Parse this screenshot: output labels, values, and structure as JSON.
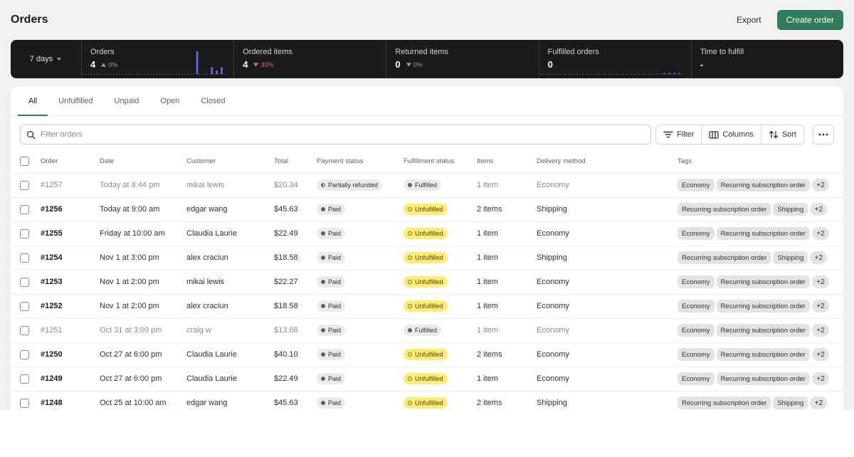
{
  "header": {
    "title": "Orders",
    "export_label": "Export",
    "create_label": "Create order"
  },
  "metrics": {
    "range_label": "7 days",
    "items": [
      {
        "label": "Orders",
        "value": "4",
        "change": "0%",
        "direction": "up",
        "negative": false,
        "spark": [
          0,
          0,
          0,
          0,
          0,
          0,
          0,
          0,
          0,
          0,
          0,
          0,
          0,
          0,
          0,
          0,
          0,
          0,
          0,
          0,
          0,
          0,
          0,
          1,
          0,
          0,
          0.3,
          0.15,
          0.3
        ]
      },
      {
        "label": "Ordered items",
        "value": "4",
        "change": "33%",
        "direction": "down",
        "negative": true,
        "spark": []
      },
      {
        "label": "Returned items",
        "value": "0",
        "change": "0%",
        "direction": "down",
        "negative": false,
        "spark": []
      },
      {
        "label": "Fulfilled orders",
        "value": "0",
        "change": "",
        "direction": "",
        "negative": false,
        "spark": [
          0,
          0,
          0,
          0,
          0,
          0,
          0,
          0,
          0,
          0,
          0,
          0,
          0,
          0,
          0,
          0,
          0,
          0,
          0,
          0,
          0,
          0,
          0,
          0,
          0,
          0.05,
          0.05,
          0.05,
          0.05
        ]
      },
      {
        "label": "Time to fulfill",
        "value": "-",
        "change": "",
        "direction": "",
        "negative": false,
        "spark": []
      }
    ]
  },
  "tabs": [
    "All",
    "Unfulfilled",
    "Unpaid",
    "Open",
    "Closed"
  ],
  "toolbar": {
    "search_placeholder": "Filter orders",
    "filter_label": "Filter",
    "columns_label": "Columns",
    "sort_label": "Sort"
  },
  "columns": [
    "Order",
    "Date",
    "Customer",
    "Total",
    "Payment status",
    "Fulfillment status",
    "Items",
    "Delivery method",
    "Tags"
  ],
  "rows": [
    {
      "order": "#1257",
      "date": "Today at 8:44 pm",
      "customer": "mikai lewis",
      "total": "$20.34",
      "payment": "Partially refunded",
      "fulfillment": "Fulfilled",
      "items": "1 item",
      "delivery": "Economy",
      "tags": [
        "Economy",
        "Recurring subscription order"
      ],
      "more": "+2",
      "muted": true
    },
    {
      "order": "#1256",
      "date": "Today at 9:00 am",
      "customer": "edgar wang",
      "total": "$45.63",
      "payment": "Paid",
      "fulfillment": "Unfulfilled",
      "items": "2 items",
      "delivery": "Shipping",
      "tags": [
        "Recurring subscription order",
        "Shipping"
      ],
      "more": "+2",
      "muted": false
    },
    {
      "order": "#1255",
      "date": "Friday at 10:00 am",
      "customer": "Claudia Laurie",
      "total": "$22.49",
      "payment": "Paid",
      "fulfillment": "Unfulfilled",
      "items": "1 item",
      "delivery": "Economy",
      "tags": [
        "Economy",
        "Recurring subscription order"
      ],
      "more": "+2",
      "muted": false
    },
    {
      "order": "#1254",
      "date": "Nov 1 at 3:00 pm",
      "customer": "alex craciun",
      "total": "$18.58",
      "payment": "Paid",
      "fulfillment": "Unfulfilled",
      "items": "1 item",
      "delivery": "Shipping",
      "tags": [
        "Recurring subscription order",
        "Shipping"
      ],
      "more": "+2",
      "muted": false
    },
    {
      "order": "#1253",
      "date": "Nov 1 at 2:00 pm",
      "customer": "mikai lewis",
      "total": "$22.27",
      "payment": "Paid",
      "fulfillment": "Unfulfilled",
      "items": "1 item",
      "delivery": "Economy",
      "tags": [
        "Economy",
        "Recurring subscription order"
      ],
      "more": "+2",
      "muted": false
    },
    {
      "order": "#1252",
      "date": "Nov 1 at 2:00 pm",
      "customer": "alex craciun",
      "total": "$18.58",
      "payment": "Paid",
      "fulfillment": "Unfulfilled",
      "items": "1 item",
      "delivery": "Economy",
      "tags": [
        "Economy",
        "Recurring subscription order"
      ],
      "more": "+2",
      "muted": false
    },
    {
      "order": "#1251",
      "date": "Oct 31 at 3:00 pm",
      "customer": "craig w",
      "total": "$13.68",
      "payment": "Paid",
      "fulfillment": "Fulfilled",
      "items": "1 item",
      "delivery": "Economy",
      "tags": [
        "Economy",
        "Recurring subscription order"
      ],
      "more": "+2",
      "muted": true
    },
    {
      "order": "#1250",
      "date": "Oct 27 at 6:00 pm",
      "customer": "Claudia Laurie",
      "total": "$40.10",
      "payment": "Paid",
      "fulfillment": "Unfulfilled",
      "items": "2 items",
      "delivery": "Economy",
      "tags": [
        "Economy",
        "Recurring subscription order"
      ],
      "more": "+2",
      "muted": false
    },
    {
      "order": "#1249",
      "date": "Oct 27 at 6:00 pm",
      "customer": "Claudia Laurie",
      "total": "$22.49",
      "payment": "Paid",
      "fulfillment": "Unfulfilled",
      "items": "1 item",
      "delivery": "Economy",
      "tags": [
        "Economy",
        "Recurring subscription order"
      ],
      "more": "+2",
      "muted": false
    },
    {
      "order": "#1248",
      "date": "Oct 25 at 10:00 am",
      "customer": "edgar wang",
      "total": "$45.63",
      "payment": "Paid",
      "fulfillment": "Unfulfilled",
      "items": "2 items",
      "delivery": "Shipping",
      "tags": [
        "Recurring subscription order",
        "Shipping"
      ],
      "more": "+2",
      "muted": false
    }
  ],
  "colors": {
    "accent": "#2f7d5b",
    "metrics_bg": "#1a1a1a",
    "spark": "#5b6fd6",
    "warning_badge": "#ffeb78"
  }
}
